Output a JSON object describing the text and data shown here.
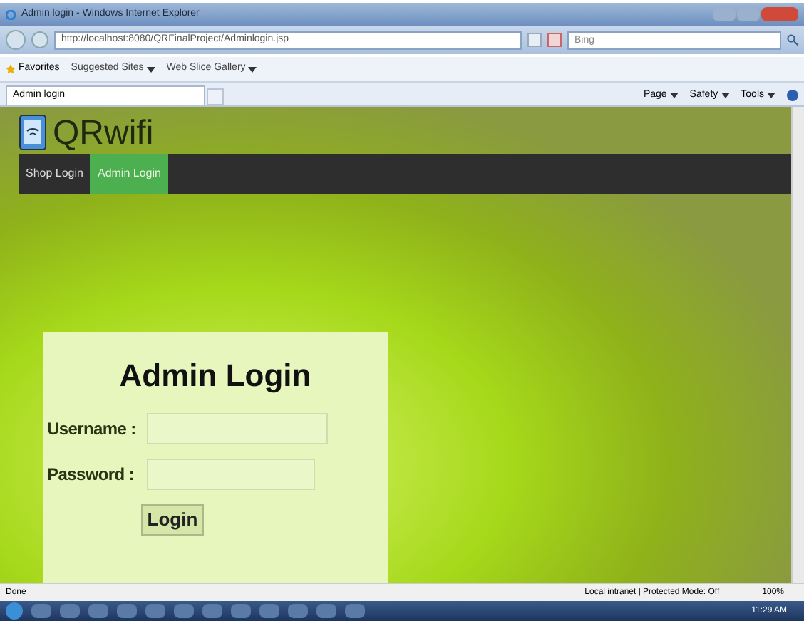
{
  "window": {
    "title": "Admin login - Windows Internet Explorer"
  },
  "address_bar": {
    "url": "http://localhost:8080/QRFinalProject/Adminlogin.jsp"
  },
  "search": {
    "placeholder": "Bing"
  },
  "favorites_bar": {
    "favorites": "Favorites",
    "items": [
      {
        "label": "Suggested Sites"
      },
      {
        "label": "Web Slice Gallery"
      }
    ]
  },
  "tabs": [
    {
      "label": "Admin login",
      "selected": true
    }
  ],
  "command_bar": [
    "Page",
    "Safety",
    "Tools"
  ],
  "site": {
    "logo": "QRwifi",
    "nav": [
      {
        "label": "Shop Login",
        "selected": false
      },
      {
        "label": "Admin Login",
        "selected": true
      }
    ]
  },
  "login_form": {
    "heading": "Admin Login",
    "fields": [
      {
        "label": "Username :"
      },
      {
        "label": "Password :"
      }
    ],
    "button": "Login"
  },
  "status_bar": {
    "status": "Done",
    "zone": "Local intranet | Protected Mode: Off",
    "zoom": "100%"
  },
  "taskbar": {
    "clock": "11:29 AM"
  }
}
